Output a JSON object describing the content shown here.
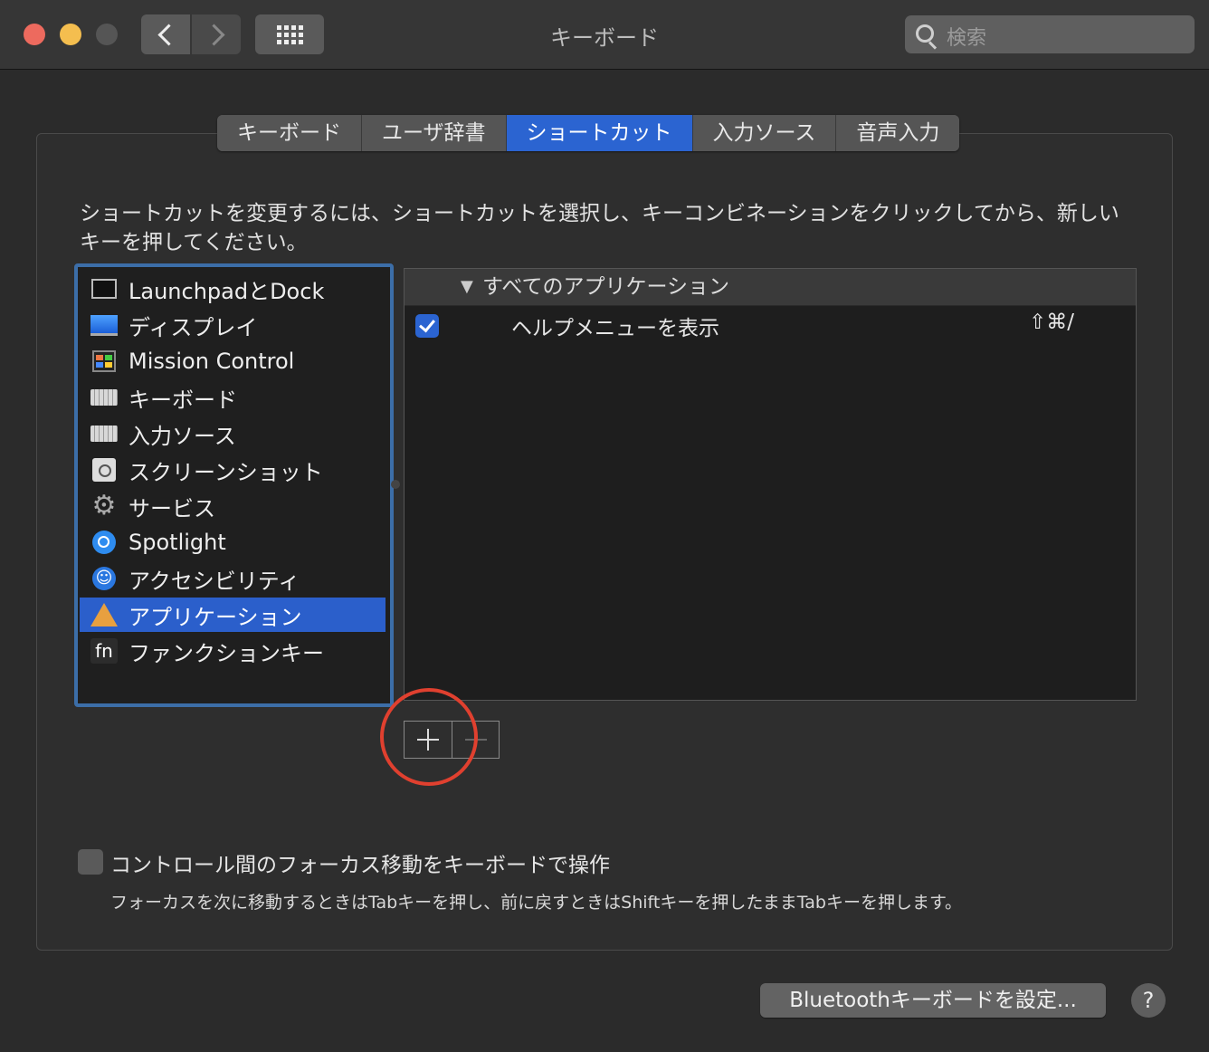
{
  "window": {
    "title": "キーボード",
    "search_placeholder": "検索"
  },
  "tabs": [
    {
      "label": "キーボード",
      "active": false
    },
    {
      "label": "ユーザ辞書",
      "active": false
    },
    {
      "label": "ショートカット",
      "active": true
    },
    {
      "label": "入力ソース",
      "active": false
    },
    {
      "label": "音声入力",
      "active": false
    }
  ],
  "description": "ショートカットを変更するには、ショートカットを選択し、キーコンビネーションをクリックしてから、新しいキーを押してください。",
  "categories": [
    {
      "label": "LaunchpadとDock",
      "icon": "launchpad-icon"
    },
    {
      "label": "ディスプレイ",
      "icon": "display-icon"
    },
    {
      "label": "Mission Control",
      "icon": "mission-control-icon"
    },
    {
      "label": "キーボード",
      "icon": "keyboard-icon"
    },
    {
      "label": "入力ソース",
      "icon": "keyboard-icon"
    },
    {
      "label": "スクリーンショット",
      "icon": "screenshot-icon"
    },
    {
      "label": "サービス",
      "icon": "gear-icon"
    },
    {
      "label": "Spotlight",
      "icon": "spotlight-icon"
    },
    {
      "label": "アクセシビリティ",
      "icon": "accessibility-icon"
    },
    {
      "label": "アプリケーション",
      "icon": "app-store-icon",
      "selected": true
    },
    {
      "label": "ファンクションキー",
      "icon": "fn-icon"
    }
  ],
  "shortcuts": {
    "group_label": "すべてのアプリケーション",
    "group_toggle": "▼",
    "rows": [
      {
        "checked": true,
        "name": "ヘルプメニューを表示",
        "keys": "⇧⌘/"
      }
    ]
  },
  "add_remove": {
    "plus": "+",
    "minus": "−"
  },
  "keyboard_navigation": {
    "label": "コントロール間のフォーカス移動をキーボードで操作",
    "checked": false,
    "note": "フォーカスを次に移動するときはTabキーを押し、前に戻すときはShiftキーを押したままTabキーを押します。"
  },
  "bluetooth_button": "Bluetoothキーボードを設定...",
  "help_button": "?",
  "colors": {
    "accent": "#2b64d1",
    "highlight_circle": "#e0402f"
  }
}
